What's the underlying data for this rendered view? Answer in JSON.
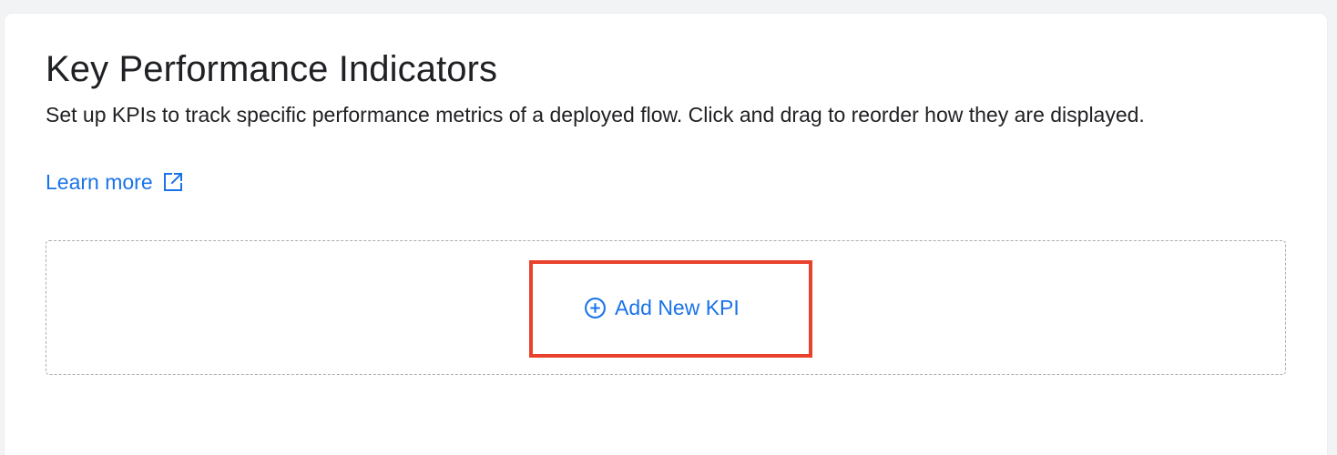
{
  "section": {
    "title": "Key Performance Indicators",
    "description": "Set up KPIs to track specific performance metrics of a deployed flow. Click and drag to reorder how they are displayed.",
    "learn_more_label": "Learn more",
    "learn_more_icon": "external-link-icon"
  },
  "kpi_list": {
    "add_button_label": "Add New KPI",
    "add_button_icon": "add-circle-icon"
  },
  "colors": {
    "link": "#1a73e8",
    "text": "#202124",
    "highlight": "#e8412c",
    "dashed_border": "#a9adb1"
  }
}
